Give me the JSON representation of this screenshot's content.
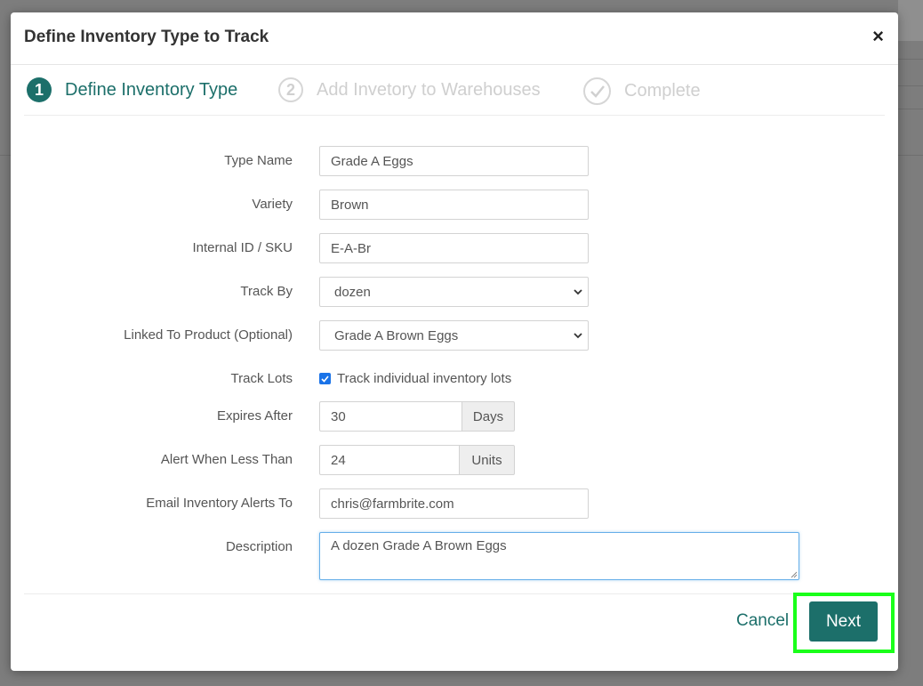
{
  "modal": {
    "title": "Define Inventory Type to Track",
    "close_label": "×"
  },
  "steps": [
    {
      "number": "1",
      "label": "Define Inventory Type",
      "state": "active"
    },
    {
      "number": "2",
      "label": "Add Invetory to Warehouses",
      "state": "inactive"
    },
    {
      "number": "",
      "label": "Complete",
      "state": "inactive",
      "icon": "check-icon"
    }
  ],
  "form": {
    "type_name": {
      "label": "Type Name",
      "value": "Grade A Eggs"
    },
    "variety": {
      "label": "Variety",
      "value": "Brown"
    },
    "sku": {
      "label": "Internal ID / SKU",
      "value": "E-A-Br"
    },
    "track_by": {
      "label": "Track By",
      "value": "dozen"
    },
    "linked_product": {
      "label": "Linked To Product (Optional)",
      "value": "Grade A Brown Eggs"
    },
    "track_lots": {
      "label": "Track Lots",
      "checkbox_label": "Track individual inventory lots",
      "checked": true
    },
    "expires_after": {
      "label": "Expires After",
      "value": "30",
      "unit": "Days"
    },
    "alert_less_than": {
      "label": "Alert When Less Than",
      "value": "24",
      "unit": "Units"
    },
    "email_alerts": {
      "label": "Email Inventory Alerts To",
      "value": "chris@farmbrite.com"
    },
    "description": {
      "label": "Description",
      "value": "A dozen Grade A Brown Eggs"
    }
  },
  "footer": {
    "cancel_label": "Cancel",
    "next_label": "Next"
  },
  "colors": {
    "accent": "#1c6f6a",
    "highlight": "#1aff1a",
    "checkbox": "#1a73e8"
  }
}
